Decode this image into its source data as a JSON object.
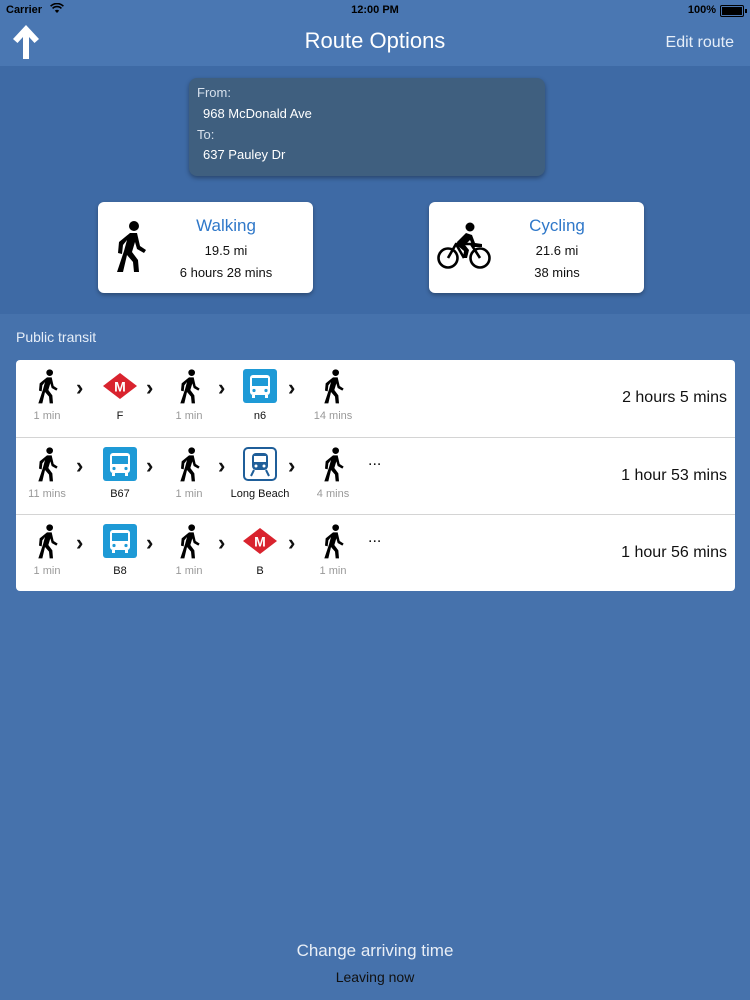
{
  "status_bar": {
    "carrier": "Carrier",
    "time": "12:00 PM",
    "battery": "100%"
  },
  "nav": {
    "title": "Route Options",
    "edit": "Edit route",
    "back_icon": "up-arrow-icon"
  },
  "route": {
    "from_label": "From:",
    "from": "968 McDonald Ave",
    "to_label": "To:",
    "to": "637 Pauley Dr"
  },
  "modes": [
    {
      "name": "Walking",
      "distance": "19.5 mi",
      "duration": "6 hours 28 mins",
      "icon": "walking-icon"
    },
    {
      "name": "Cycling",
      "distance": "21.6 mi",
      "duration": "38 mins",
      "icon": "bicycle-icon"
    }
  ],
  "transit": {
    "title": "Public transit",
    "routes": [
      {
        "steps": [
          {
            "type": "walk",
            "label": "1 min"
          },
          {
            "type": "metro",
            "label": "F"
          },
          {
            "type": "walk",
            "label": "1 min"
          },
          {
            "type": "bus",
            "label": "n6"
          },
          {
            "type": "walk",
            "label": "14 mins"
          }
        ],
        "more": "",
        "duration": "2 hours 5 mins"
      },
      {
        "steps": [
          {
            "type": "walk",
            "label": "11 mins"
          },
          {
            "type": "bus",
            "label": "B67"
          },
          {
            "type": "walk",
            "label": "1 min"
          },
          {
            "type": "train",
            "label": "Long Beach"
          },
          {
            "type": "walk",
            "label": "4 mins"
          }
        ],
        "more": "...",
        "duration": "1 hour 53 mins"
      },
      {
        "steps": [
          {
            "type": "walk",
            "label": "1 min"
          },
          {
            "type": "bus",
            "label": "B8"
          },
          {
            "type": "walk",
            "label": "1 min"
          },
          {
            "type": "metro",
            "label": "B"
          },
          {
            "type": "walk",
            "label": "1 min"
          }
        ],
        "more": "...",
        "duration": "1 hour 56 mins"
      }
    ]
  },
  "footer": {
    "change": "Change arriving time",
    "leaving": "Leaving now"
  },
  "colors": {
    "background": "#4672ac",
    "metro": "#d9232e",
    "bus": "#1e9ad6",
    "link": "#2f78c9"
  }
}
